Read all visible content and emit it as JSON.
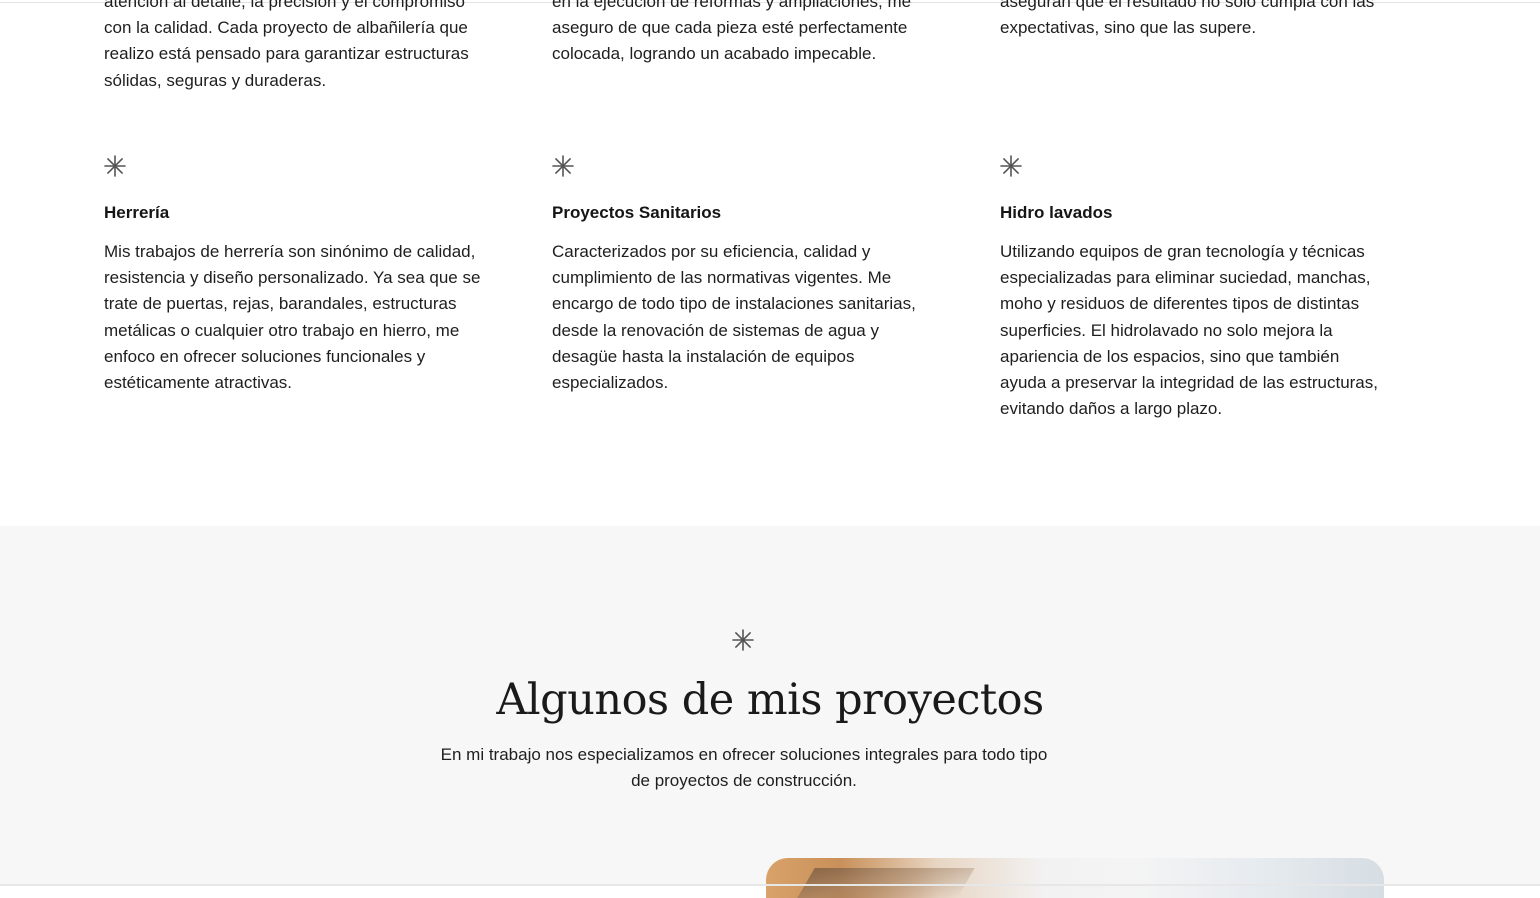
{
  "top_row": [
    {
      "text": "atención al detalle, la precisión y el compromiso con la calidad. Cada proyecto de albañilería que realizo está pensado para garantizar estructuras sólidas, seguras y duraderas."
    },
    {
      "text": "en la ejecución de reformas y ampliaciones, me aseguro de que cada pieza esté perfectamente colocada, logrando un acabado impecable."
    },
    {
      "text": "aseguran que el resultado no solo cumpla con las expectativas, sino que las supere."
    }
  ],
  "services": [
    {
      "icon": "asterisk-icon",
      "title": "Herrería",
      "description": "Mis trabajos de herrería son sinónimo de calidad, resistencia y diseño personalizado. Ya sea que se trate de puertas, rejas, barandales, estructuras metálicas o cualquier otro trabajo en hierro, me enfoco en ofrecer soluciones funcionales y estéticamente atractivas."
    },
    {
      "icon": "asterisk-icon",
      "title": "Proyectos Sanitarios",
      "description": "Caracterizados por su eficiencia, calidad y cumplimiento de las normativas vigentes. Me encargo de todo tipo de instalaciones sanitarias, desde la renovación de sistemas de agua y desagüe hasta la instalación de equipos especializados."
    },
    {
      "icon": "asterisk-icon",
      "title": "Hidro lavados",
      "description": "Utilizando equipos de gran tecnología y técnicas especializadas para eliminar suciedad, manchas, moho y residuos de diferentes tipos de distintas superficies. El hidrolavado no solo mejora la apariencia de los espacios, sino que también ayuda a preservar la integridad de las estructuras, evitando daños a largo plazo."
    }
  ],
  "projects": {
    "icon": "asterisk-icon",
    "title": "Algunos de mis proyectos",
    "subtitle": "En mi trabajo nos especializamos en ofrecer soluciones integrales para todo tipo de proyectos de construcción."
  },
  "colors": {
    "text": "#1e1e1e",
    "icon": "#555555",
    "section_bg": "#f7f7f7",
    "page_bg": "#ffffff"
  }
}
